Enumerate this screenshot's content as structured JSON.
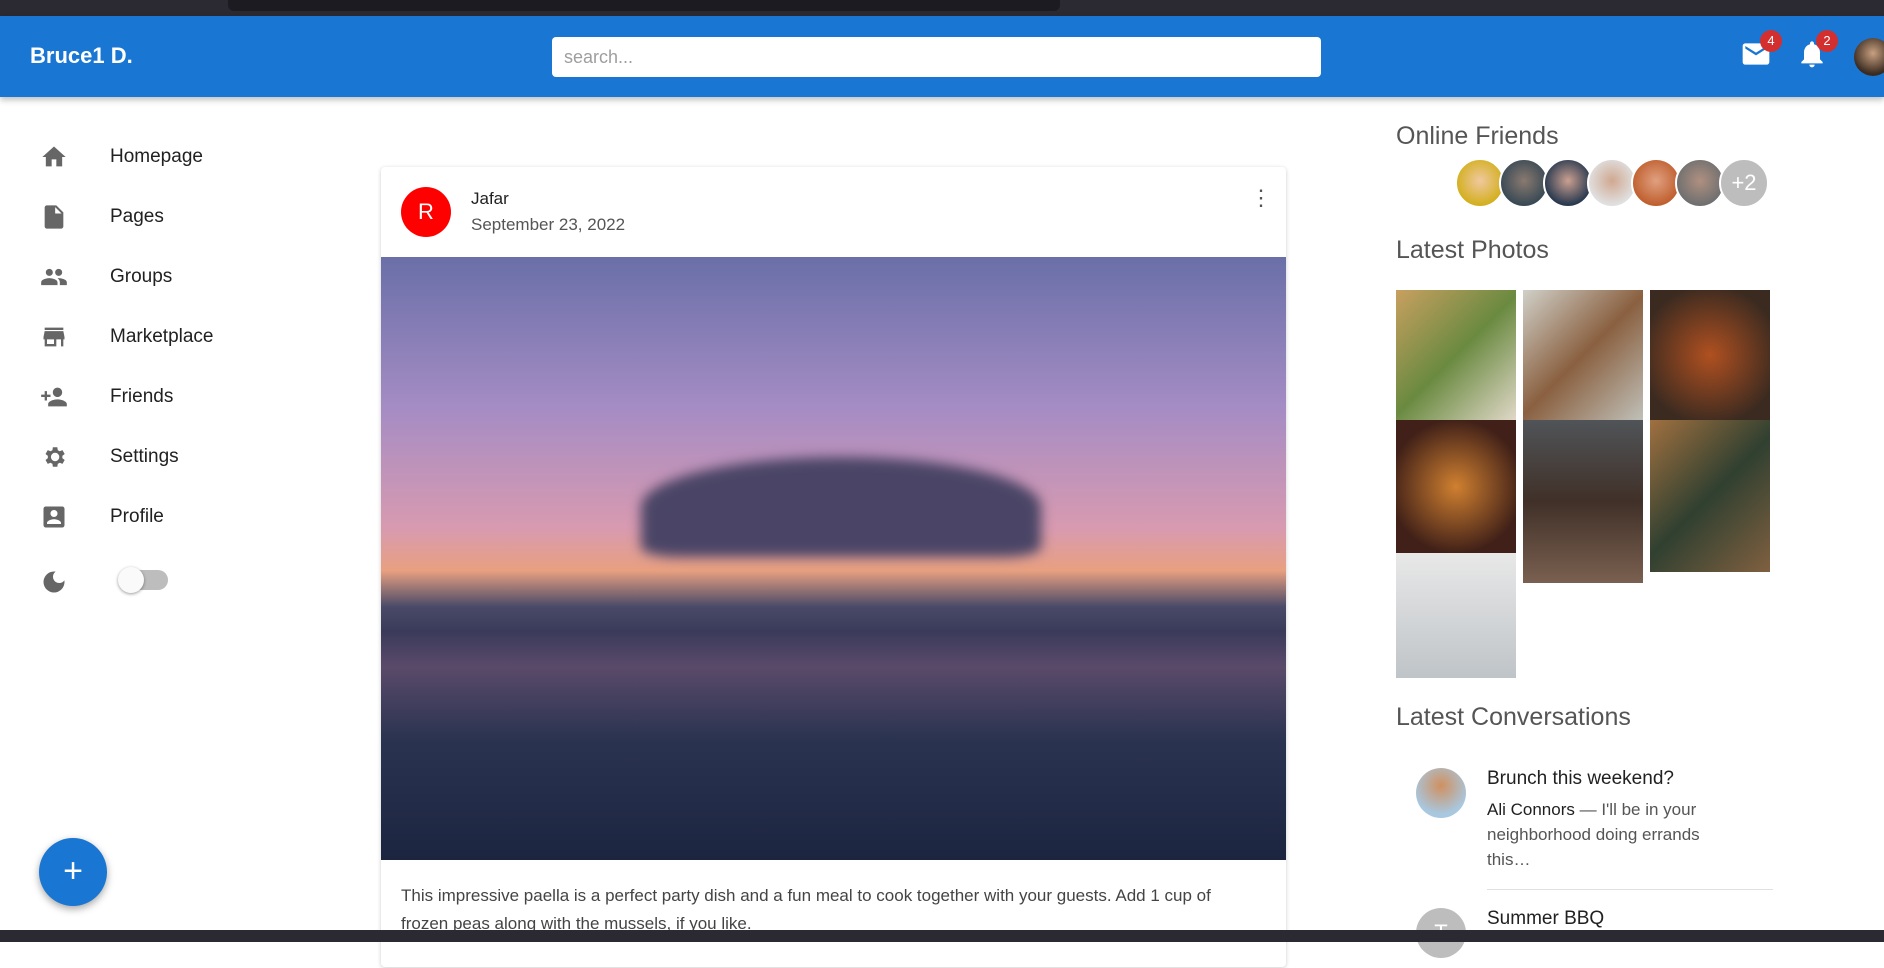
{
  "appbar": {
    "title": "Bruce1 D.",
    "search_placeholder": "search...",
    "mail_badge": "4",
    "notif_badge": "2"
  },
  "sidebar": {
    "items": [
      {
        "label": "Homepage",
        "icon": "home-icon"
      },
      {
        "label": "Pages",
        "icon": "file-icon"
      },
      {
        "label": "Groups",
        "icon": "groups-icon"
      },
      {
        "label": "Marketplace",
        "icon": "store-icon"
      },
      {
        "label": "Friends",
        "icon": "person-add-icon"
      },
      {
        "label": "Settings",
        "icon": "gear-icon"
      },
      {
        "label": "Profile",
        "icon": "account-box-icon"
      }
    ],
    "dark_mode": false
  },
  "fab": {
    "label": "+"
  },
  "post": {
    "avatar_letter": "R",
    "author": "Jafar",
    "date": "September 23, 2022",
    "avatar_color": "#ff0000",
    "caption": "This impressive paella is a perfect party dish and a fun meal to cook together with your guests. Add 1 cup of frozen peas along with the mussels, if you like."
  },
  "right": {
    "online_title": "Online Friends",
    "online_more": "+2",
    "photos_title": "Latest Photos",
    "conv_title": "Latest Conversations",
    "conversations": [
      {
        "title": "Brunch this weekend?",
        "sender": "Ali Connors",
        "text": " — I'll be in your neighborhood doing errands this…"
      },
      {
        "title": "Summer BBQ",
        "avatar_letter": "T"
      }
    ]
  },
  "colors": {
    "primary": "#1976d2",
    "badge": "#d32f2f"
  }
}
